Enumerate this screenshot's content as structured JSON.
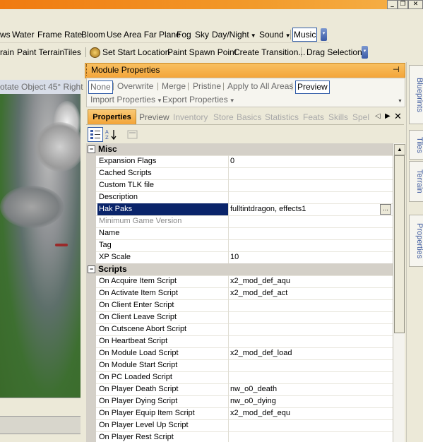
{
  "toolbar1": {
    "items": [
      "ws",
      "Water",
      "Frame Rate",
      "Bloom",
      "Use Area Far Plane",
      "Fog",
      "Sky",
      "Day/Night",
      "Sound",
      "Music"
    ]
  },
  "toolbar2": {
    "items": [
      "rain",
      "Paint Terrain",
      "Tiles",
      "Set Start Location",
      "Paint Spawn Point",
      "Create Transition...",
      "Drag Selection"
    ]
  },
  "viewport": {
    "header": "otate Object 45° Right"
  },
  "panel": {
    "title": "Module Properties",
    "merge_options": [
      "None",
      "Overwrite",
      "Merge",
      "Pristine",
      "Apply to All Areas",
      "Preview"
    ],
    "import_label": "Import Properties",
    "export_label": "Export Properties",
    "tabs": [
      "Properties",
      "Preview",
      "Inventory",
      "Store",
      "Basics",
      "Statistics",
      "Feats",
      "Skills",
      "Spel"
    ]
  },
  "grid": {
    "misc_label": "Misc",
    "scripts_label": "Scripts",
    "misc_rows": [
      {
        "name": "Expansion Flags",
        "value": "0"
      },
      {
        "name": "Cached Scripts",
        "value": ""
      },
      {
        "name": "Custom TLK file",
        "value": ""
      },
      {
        "name": "Description",
        "value": ""
      },
      {
        "name": "Hak Paks",
        "value": "fulltintdragon, effects1"
      },
      {
        "name": "Minimum Game Version",
        "value": ""
      },
      {
        "name": "Name",
        "value": ""
      },
      {
        "name": "Tag",
        "value": ""
      },
      {
        "name": "XP Scale",
        "value": "10"
      }
    ],
    "script_rows": [
      {
        "name": "On Acquire Item Script",
        "value": "x2_mod_def_aqu"
      },
      {
        "name": "On Activate Item Script",
        "value": "x2_mod_def_act"
      },
      {
        "name": "On Client Enter Script",
        "value": ""
      },
      {
        "name": "On Client Leave Script",
        "value": ""
      },
      {
        "name": "On Cutscene Abort Script",
        "value": ""
      },
      {
        "name": "On Heartbeat Script",
        "value": ""
      },
      {
        "name": "On Module Load Script",
        "value": "x2_mod_def_load"
      },
      {
        "name": "On Module Start Script",
        "value": ""
      },
      {
        "name": "On PC Loaded Script",
        "value": ""
      },
      {
        "name": "On Player Death Script",
        "value": "nw_o0_death"
      },
      {
        "name": "On Player Dying Script",
        "value": "nw_o0_dying"
      },
      {
        "name": "On Player Equip Item Script",
        "value": "x2_mod_def_equ"
      },
      {
        "name": "On Player Level Up Script",
        "value": ""
      },
      {
        "name": "On Player Rest Script",
        "value": ""
      }
    ]
  },
  "right_dock": {
    "tabs": [
      "Blueprints",
      "Tiles",
      "Terrain",
      "Properties"
    ]
  },
  "colors": {
    "selection": "#0a246a",
    "accent_orange": "#f3a53a",
    "tab_text_blue": "#3d5aa0"
  }
}
